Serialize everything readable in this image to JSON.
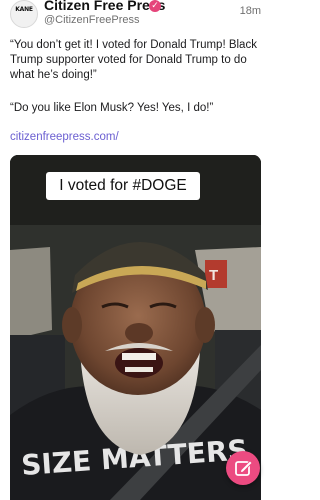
{
  "post": {
    "avatar_text": "KANE",
    "display_name": "Citizen Free Press",
    "handle": "@CitizenFreePress",
    "timestamp": "18m",
    "paragraph_1": "“You don’t get it! I voted for Donald Trump! Black Trump supporter voted for Donald Trump to do what he’s doing!”",
    "paragraph_2": "“Do you like Elon Musk? Yes! Yes, I do!”",
    "link_text": "citizenfreepress.com/"
  },
  "media": {
    "caption": "I voted for #DOGE",
    "shirt_text": "SIZE MATTERS",
    "sign_text": "T"
  },
  "fab": {
    "icon": "compose-icon"
  },
  "colors": {
    "verified_badge": "#e5447a",
    "link": "#6b5fd1",
    "fab": "#ec4b81"
  }
}
